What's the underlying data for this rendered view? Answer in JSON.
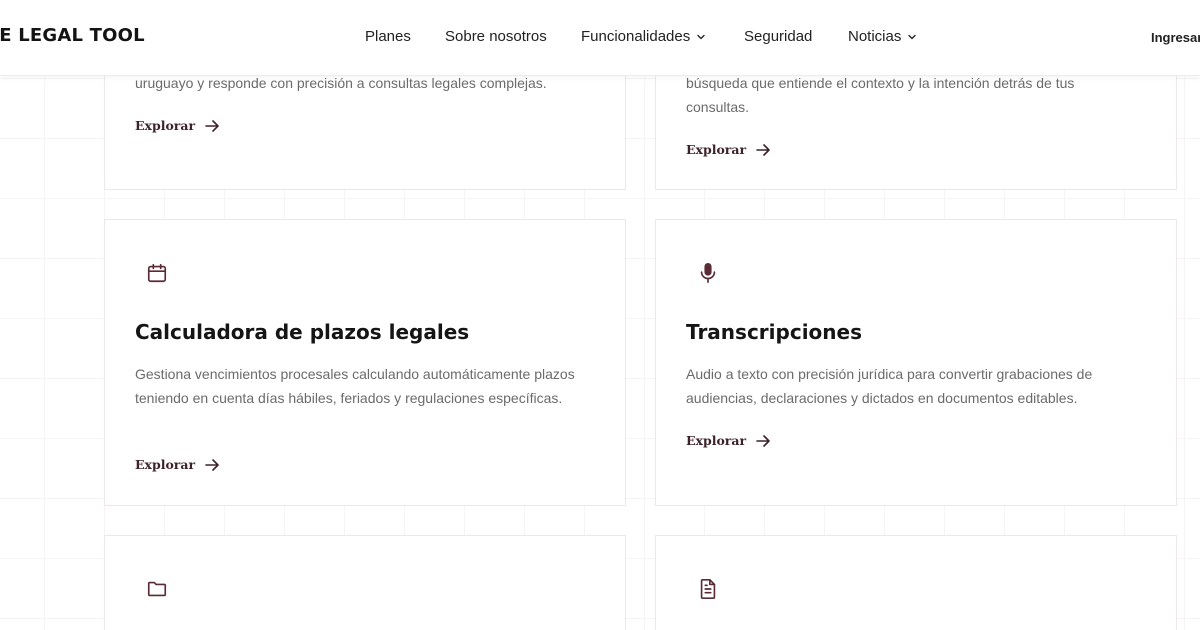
{
  "header": {
    "logo": "HE LEGAL TOOL",
    "login_label": "Ingresar",
    "nav": [
      {
        "label": "Planes",
        "dropdown": false
      },
      {
        "label": "Sobre nosotros",
        "dropdown": false
      },
      {
        "label": "Funcionalidades",
        "dropdown": true
      },
      {
        "label": "Seguridad",
        "dropdown": false
      },
      {
        "label": "Noticias",
        "dropdown": true
      }
    ]
  },
  "colors": {
    "accent": "#5a2a35",
    "link": "#3d2229",
    "text_muted": "#6b6b6b"
  },
  "cards": [
    {
      "title": "",
      "description": "uruguayo y responde con precisión a consultas legales complejas.",
      "link": "Explorar"
    },
    {
      "title": "",
      "description": "búsqueda que entiende el contexto y la intención detrás de tus consultas.",
      "link": "Explorar"
    },
    {
      "icon": "calendar-icon",
      "title": "Calculadora de plazos legales",
      "description": "Gestiona vencimientos procesales calculando automáticamente plazos teniendo en cuenta días hábiles, feriados y regulaciones específicas.",
      "link": "Explorar"
    },
    {
      "icon": "microphone-icon",
      "title": "Transcripciones",
      "description": "Audio a texto con precisión jurídica para convertir grabaciones de audiencias, declaraciones y dictados en documentos editables.",
      "link": "Explorar"
    },
    {
      "icon": "folder-icon",
      "title": "",
      "description": "",
      "link": ""
    },
    {
      "icon": "document-icon",
      "title": "",
      "description": "",
      "link": ""
    }
  ]
}
